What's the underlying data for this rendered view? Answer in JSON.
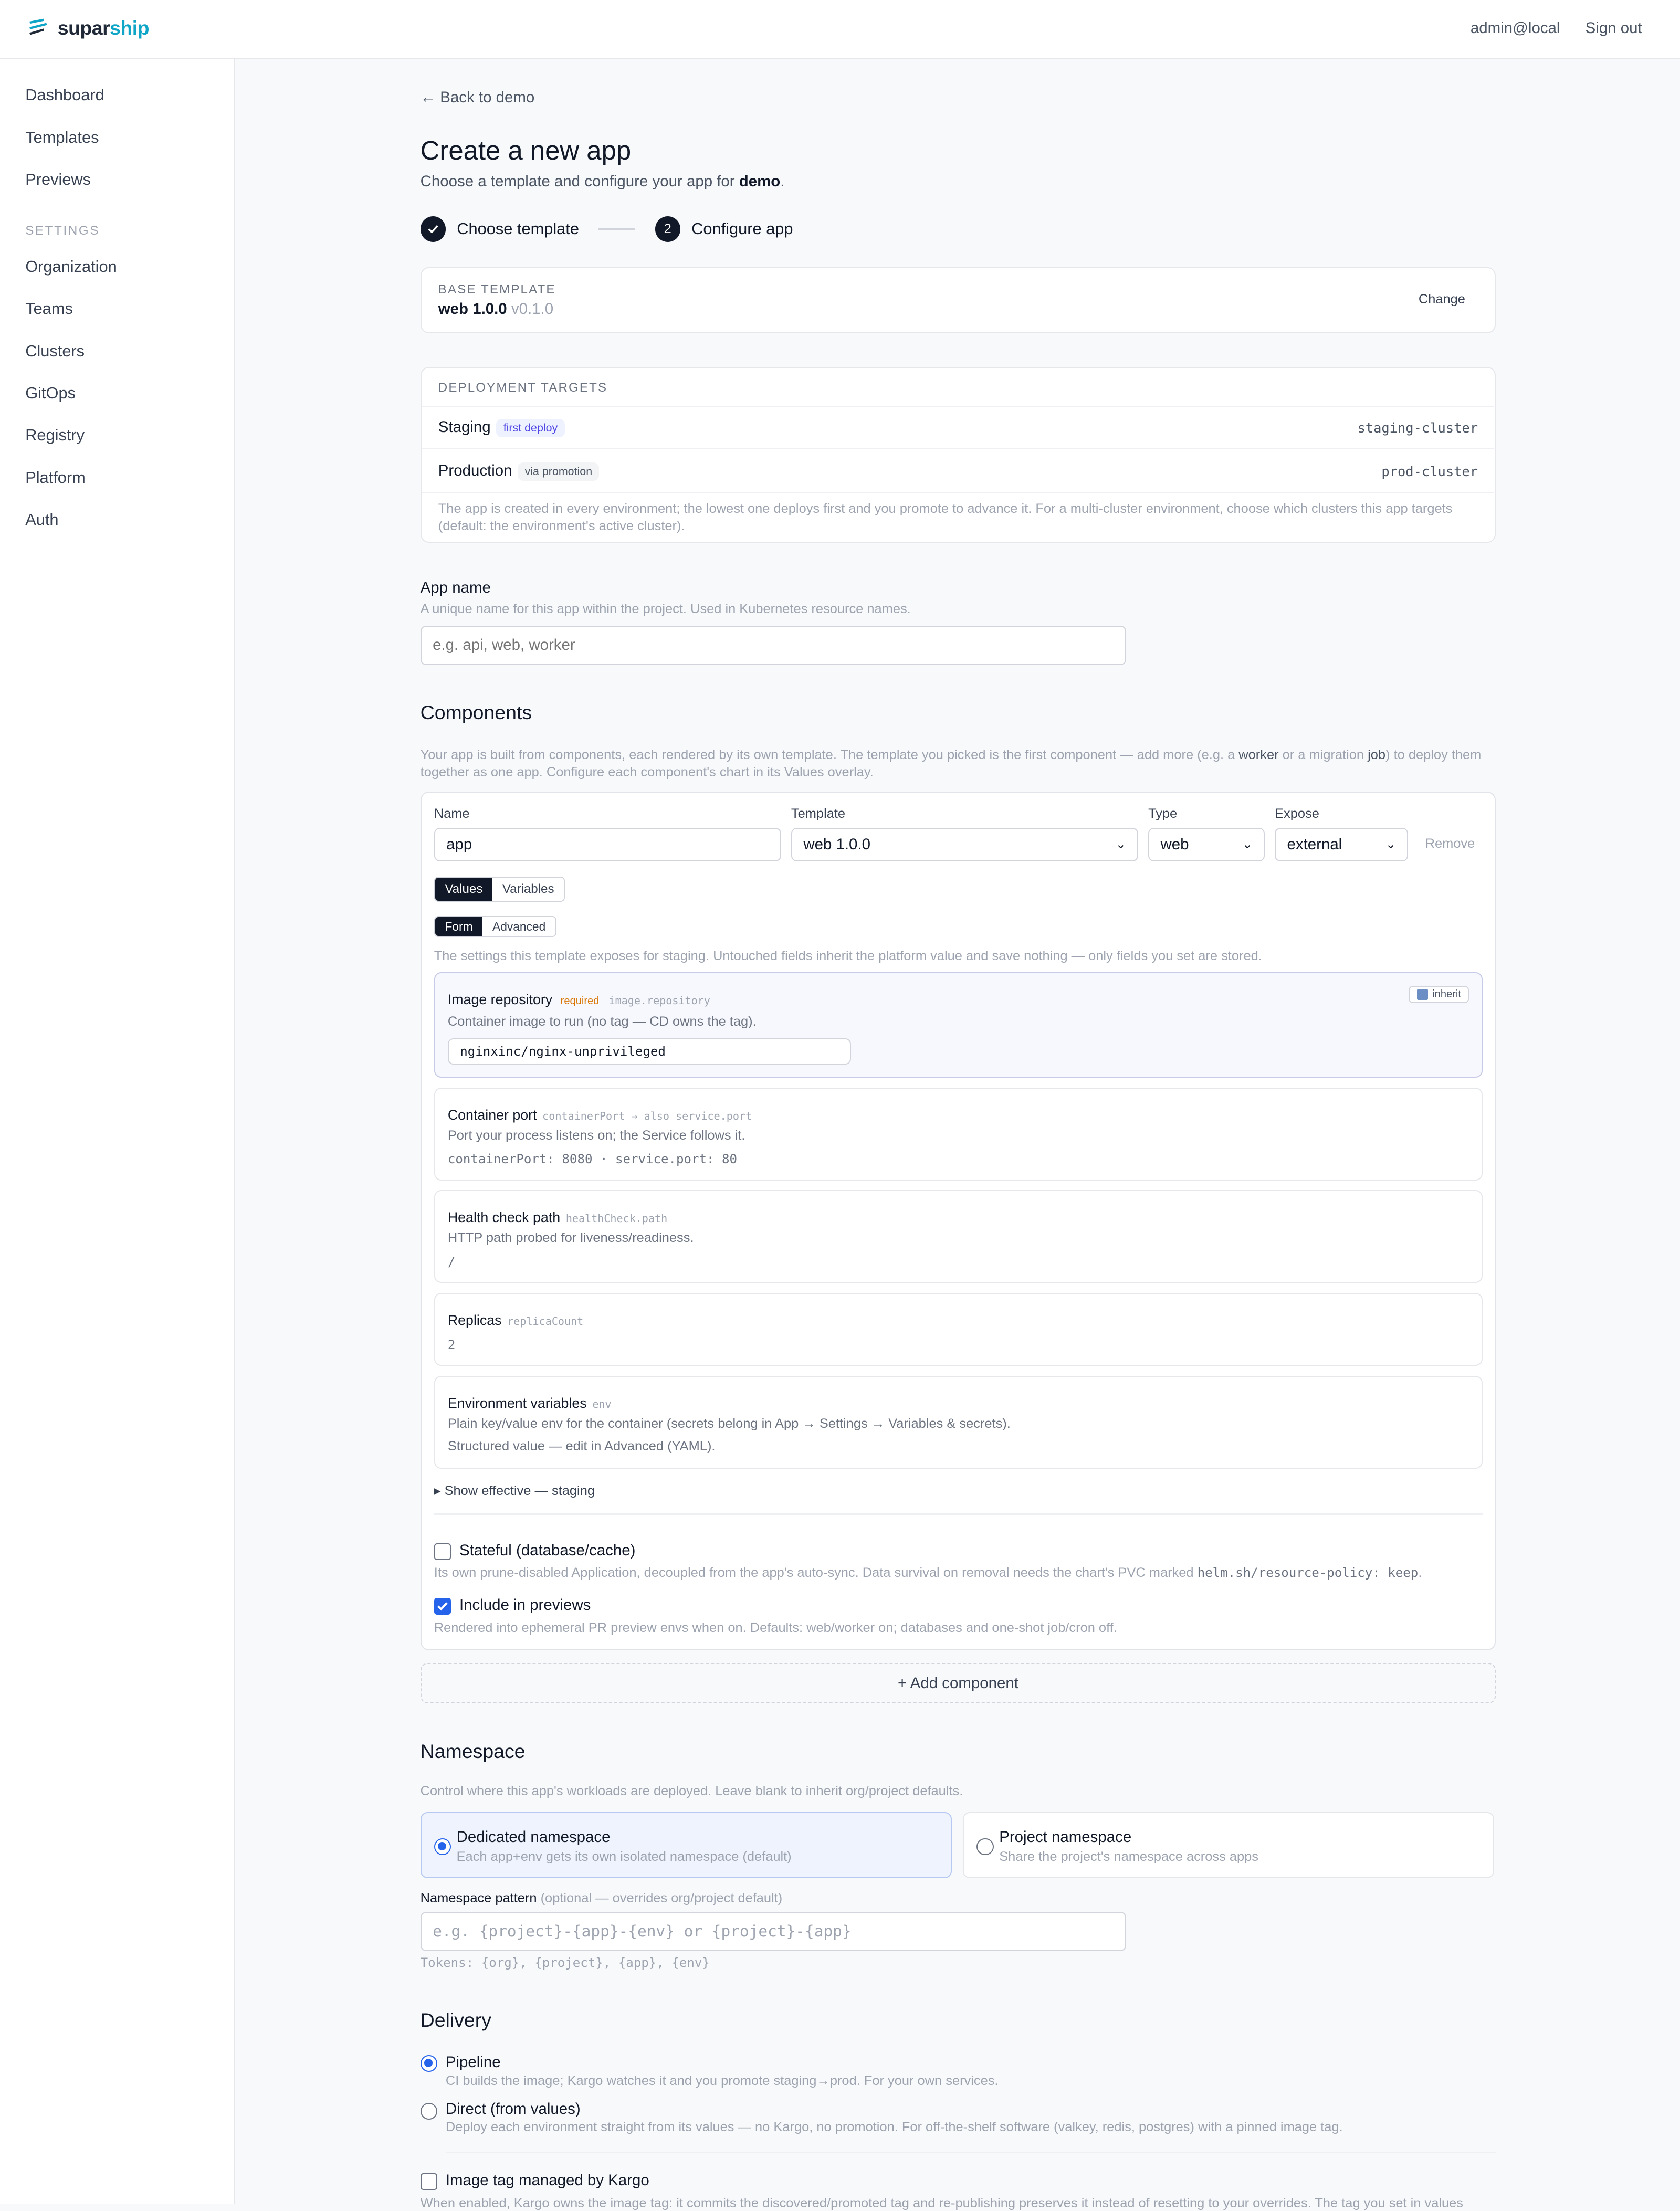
{
  "brand": {
    "name_a": "supar",
    "name_b": "ship"
  },
  "header": {
    "user": "admin@local",
    "signout": "Sign out"
  },
  "sidebar": {
    "items": [
      "Dashboard",
      "Templates",
      "Previews"
    ],
    "settings_title": "SETTINGS",
    "settings_items": [
      "Organization",
      "Teams",
      "Clusters",
      "GitOps",
      "Registry",
      "Platform",
      "Auth"
    ]
  },
  "page": {
    "back": "← Back to demo",
    "title": "Create a new app",
    "subtitle_pre": "Choose a template and configure your app for ",
    "subtitle_project": "demo",
    "subtitle_post": ".",
    "step1": "Choose template",
    "step2_num": "2",
    "step2": "Configure app"
  },
  "base_template": {
    "caption": "BASE TEMPLATE",
    "name": "web 1.0.0",
    "version": "v0.1.0",
    "change": "Change"
  },
  "deployment": {
    "caption": "DEPLOYMENT TARGETS",
    "targets": [
      {
        "env": "Staging",
        "badge": "first deploy",
        "cluster": "staging-cluster"
      },
      {
        "env": "Production",
        "badge": "via promotion",
        "cluster": "prod-cluster"
      }
    ],
    "note1": "The app is created in every environment; the lowest one deploys first and you promote to advance it. For a multi-cluster environment, choose which clusters this app targets",
    "note2": "(default: the environment's active cluster)."
  },
  "app_name": {
    "label": "App name",
    "help": "A unique name for this app within the project. Used in Kubernetes resource names.",
    "placeholder": "e.g. api, web, worker"
  },
  "components": {
    "title": "Components",
    "desc1_pre": "Your app is built from components, each rendered by its own template. The template you picked is the first component — add more (e.g. a ",
    "desc1_worker": "worker",
    "desc1_mid": " or a migration ",
    "desc1_job": "job",
    "desc1_post": ") to deploy them",
    "desc2": "together as one app. Configure each component's chart in its Values overlay.",
    "name_label": "Name",
    "name_value": "app",
    "template_label": "Template",
    "template_value": "web 1.0.0",
    "type_label": "Type",
    "type_value": "web",
    "expose_label": "Expose",
    "expose_value": "external",
    "remove": "Remove",
    "tab_values": "Values",
    "tab_variables": "Variables",
    "tab_form": "Form",
    "tab_advanced": "Advanced",
    "form_note": "The settings this template exposes for staging. Untouched fields inherit the platform value and save nothing — only fields you set are stored.",
    "fields": {
      "image": {
        "title": "Image repository",
        "required": "required",
        "key": "image.repository",
        "desc": "Container image to run (no tag — CD owns the tag).",
        "value": "nginxinc/nginx-unprivileged",
        "inherit": "inherit"
      },
      "port": {
        "title": "Container port",
        "key": "containerPort → also service.port",
        "desc": "Port your process listens on; the Service follows it.",
        "value": "containerPort: 8080 · service.port: 80"
      },
      "health": {
        "title": "Health check path",
        "key": "healthCheck.path",
        "desc": "HTTP path probed for liveness/readiness.",
        "value": "/"
      },
      "replicas": {
        "title": "Replicas",
        "key": "replicaCount",
        "value": "2"
      },
      "env": {
        "title": "Environment variables",
        "key": "env",
        "desc": "Plain key/value env for the container (secrets belong in App → Settings → Variables & secrets).",
        "value": "Structured value — edit in Advanced (YAML)."
      }
    },
    "show_effective": "▸ Show effective — staging",
    "stateful_label": "Stateful (database/cache)",
    "stateful_desc_pre": "Its own prune-disabled Application, decoupled from the app's auto-sync. Data survival on removal needs the chart's PVC marked ",
    "stateful_desc_code": "helm.sh/resource-policy: keep",
    "stateful_desc_post": ".",
    "previews_label": "Include in previews",
    "previews_desc": "Rendered into ephemeral PR preview envs when on. Defaults: web/worker on; databases and one-shot job/cron off.",
    "add": "+ Add component"
  },
  "namespace": {
    "title": "Namespace",
    "desc": "Control where this app's workloads are deployed. Leave blank to inherit org/project defaults.",
    "opt1_title": "Dedicated namespace",
    "opt1_desc": "Each app+env gets its own isolated namespace (default)",
    "opt2_title": "Project namespace",
    "opt2_desc": "Share the project's namespace across apps",
    "pattern_label": "Namespace pattern",
    "pattern_hint": "(optional — overrides org/project default)",
    "pattern_placeholder": "e.g. {project}-{app}-{env}  or  {project}-{app}",
    "tokens": "Tokens: {org}, {project}, {app}, {env}"
  },
  "delivery": {
    "title": "Delivery",
    "pipeline_title": "Pipeline",
    "pipeline_desc": "CI builds the image; Kargo watches it and you promote staging→prod. For your own services.",
    "direct_title": "Direct (from values)",
    "direct_desc": "Deploy each environment straight from its values — no Kargo, no promotion. For off-the-shelf software (valkey, redis, postgres) with a pinned image tag.",
    "kargo_label": "Image tag managed by Kargo",
    "kargo_desc": "When enabled, Kargo owns the image tag: it commits the discovered/promoted tag and re-publishing preserves it instead of resetting to your overrides. The tag you set in values"
  },
  "colors": {
    "accent": "#2563eb",
    "brand": "#0ea5c6",
    "dark": "#111827"
  }
}
